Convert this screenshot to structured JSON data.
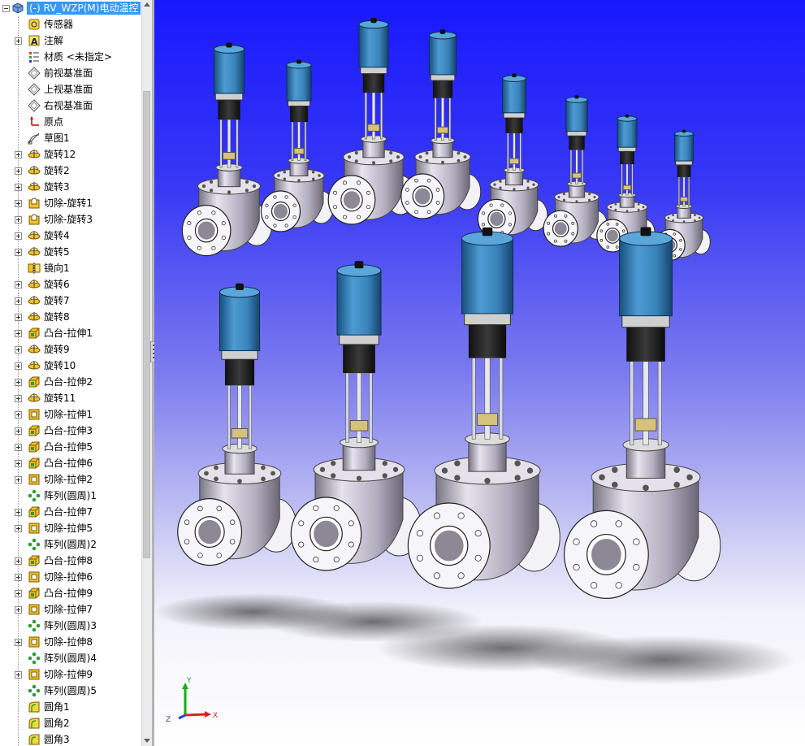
{
  "feature_tree": {
    "root": {
      "label": "(-) RV_WZP(M)电动温控"
    },
    "items": [
      {
        "label": "传感器",
        "icon": "sensor-icon",
        "expandable": false
      },
      {
        "label": "注解",
        "icon": "annotation-icon",
        "expandable": true
      },
      {
        "label": "材质 <未指定>",
        "icon": "material-icon",
        "expandable": false
      },
      {
        "label": "前视基准面",
        "icon": "plane-icon",
        "expandable": false
      },
      {
        "label": "上视基准面",
        "icon": "plane-icon",
        "expandable": false
      },
      {
        "label": "右视基准面",
        "icon": "plane-icon",
        "expandable": false
      },
      {
        "label": "原点",
        "icon": "origin-icon",
        "expandable": false
      },
      {
        "label": "草图1",
        "icon": "sketch-icon",
        "expandable": false
      },
      {
        "label": "旋转12",
        "icon": "revolve-icon",
        "expandable": true
      },
      {
        "label": "旋转2",
        "icon": "revolve-icon",
        "expandable": true
      },
      {
        "label": "旋转3",
        "icon": "revolve-icon",
        "expandable": true
      },
      {
        "label": "切除-旋转1",
        "icon": "cut-revolve-icon",
        "expandable": true
      },
      {
        "label": "切除-旋转3",
        "icon": "cut-revolve-icon",
        "expandable": true
      },
      {
        "label": "旋转4",
        "icon": "revolve-icon",
        "expandable": true
      },
      {
        "label": "旋转5",
        "icon": "revolve-icon",
        "expandable": true
      },
      {
        "label": "镜向1",
        "icon": "mirror-icon",
        "expandable": false
      },
      {
        "label": "旋转6",
        "icon": "revolve-icon",
        "expandable": true
      },
      {
        "label": "旋转7",
        "icon": "revolve-icon",
        "expandable": true
      },
      {
        "label": "旋转8",
        "icon": "revolve-icon",
        "expandable": true
      },
      {
        "label": "凸台-拉伸1",
        "icon": "boss-extrude-icon",
        "expandable": true
      },
      {
        "label": "旋转9",
        "icon": "revolve-icon",
        "expandable": true
      },
      {
        "label": "旋转10",
        "icon": "revolve-icon",
        "expandable": true
      },
      {
        "label": "凸台-拉伸2",
        "icon": "boss-extrude-icon",
        "expandable": true
      },
      {
        "label": "旋转11",
        "icon": "revolve-icon",
        "expandable": true
      },
      {
        "label": "切除-拉伸1",
        "icon": "cut-extrude-icon",
        "expandable": true
      },
      {
        "label": "凸台-拉伸3",
        "icon": "boss-extrude-icon",
        "expandable": true
      },
      {
        "label": "凸台-拉伸5",
        "icon": "boss-extrude-icon",
        "expandable": true
      },
      {
        "label": "凸台-拉伸6",
        "icon": "boss-extrude-icon",
        "expandable": true
      },
      {
        "label": "切除-拉伸2",
        "icon": "cut-extrude-icon",
        "expandable": true
      },
      {
        "label": "阵列(圆周)1",
        "icon": "circular-pattern-icon",
        "expandable": false
      },
      {
        "label": "凸台-拉伸7",
        "icon": "boss-extrude-icon",
        "expandable": true
      },
      {
        "label": "切除-拉伸5",
        "icon": "cut-extrude-icon",
        "expandable": true
      },
      {
        "label": "阵列(圆周)2",
        "icon": "circular-pattern-icon",
        "expandable": false
      },
      {
        "label": "凸台-拉伸8",
        "icon": "boss-extrude-icon",
        "expandable": true
      },
      {
        "label": "切除-拉伸6",
        "icon": "cut-extrude-icon",
        "expandable": true
      },
      {
        "label": "凸台-拉伸9",
        "icon": "boss-extrude-icon",
        "expandable": true
      },
      {
        "label": "切除-拉伸7",
        "icon": "cut-extrude-icon",
        "expandable": true
      },
      {
        "label": "阵列(圆周)3",
        "icon": "circular-pattern-icon",
        "expandable": false
      },
      {
        "label": "切除-拉伸8",
        "icon": "cut-extrude-icon",
        "expandable": true
      },
      {
        "label": "阵列(圆周)4",
        "icon": "circular-pattern-icon",
        "expandable": false
      },
      {
        "label": "切除-拉伸9",
        "icon": "cut-extrude-icon",
        "expandable": true
      },
      {
        "label": "阵列(圆周)5",
        "icon": "circular-pattern-icon",
        "expandable": false
      },
      {
        "label": "圆角1",
        "icon": "fillet-icon",
        "expandable": false
      },
      {
        "label": "圆角2",
        "icon": "fillet-icon",
        "expandable": false
      },
      {
        "label": "圆角3",
        "icon": "fillet-icon",
        "expandable": false
      }
    ]
  },
  "triad": {
    "x_label": "X",
    "y_label": "Y",
    "z_label": "Z"
  },
  "colors": {
    "selection": "#3399ff",
    "viewport_top": "#1818ff",
    "viewport_bottom": "#ffffff",
    "actuator_blue": "#3d8bc4",
    "valve_body": "#b9b4c4"
  }
}
